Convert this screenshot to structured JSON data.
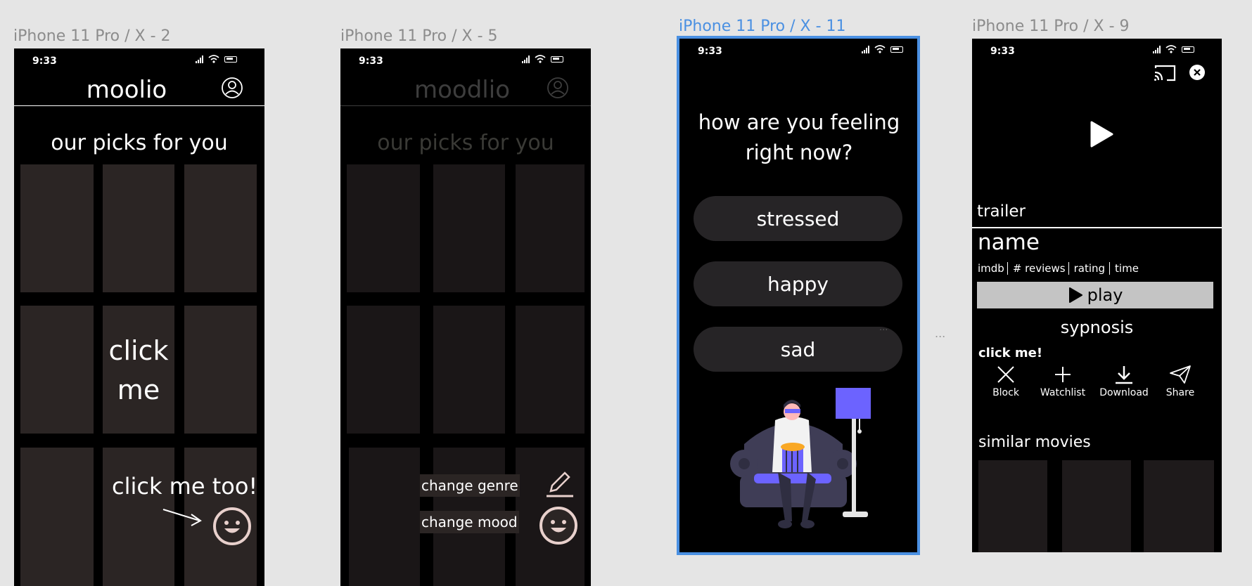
{
  "frames": {
    "f1": {
      "label": "iPhone 11 Pro / X - 2"
    },
    "f2": {
      "label": "iPhone 11 Pro / X - 5"
    },
    "f3": {
      "label": "iPhone 11 Pro / X - 11"
    },
    "f4": {
      "label": "iPhone 11 Pro / X - 9"
    }
  },
  "status": {
    "time": "9:33"
  },
  "screen1": {
    "app_title": "moolio",
    "heading": "our picks for you",
    "click_me": "click me",
    "click_me_too": "click me too!"
  },
  "screen2": {
    "app_title": "moodlio",
    "heading": "our picks for you",
    "change_genre": "change genre",
    "change_mood": "change mood"
  },
  "screen3": {
    "question": "how are you feeling right now?",
    "moods": [
      "stressed",
      "happy",
      "sad"
    ]
  },
  "screen4": {
    "trailer": "trailer",
    "name": "name",
    "meta": [
      "imdb",
      "# reviews",
      "rating",
      "time"
    ],
    "play": "play",
    "synopsis": "sypnosis",
    "click_me": "click me!",
    "actions": [
      "Block",
      "Watchlist",
      "Download",
      "Share"
    ],
    "similar": "similar movies"
  },
  "canvas": {
    "ellipsis": "..."
  },
  "colors": {
    "selection": "#4a90e2",
    "tile": "#2b2524",
    "lamp": "#6c63ff",
    "face": "#e8d0cc"
  }
}
